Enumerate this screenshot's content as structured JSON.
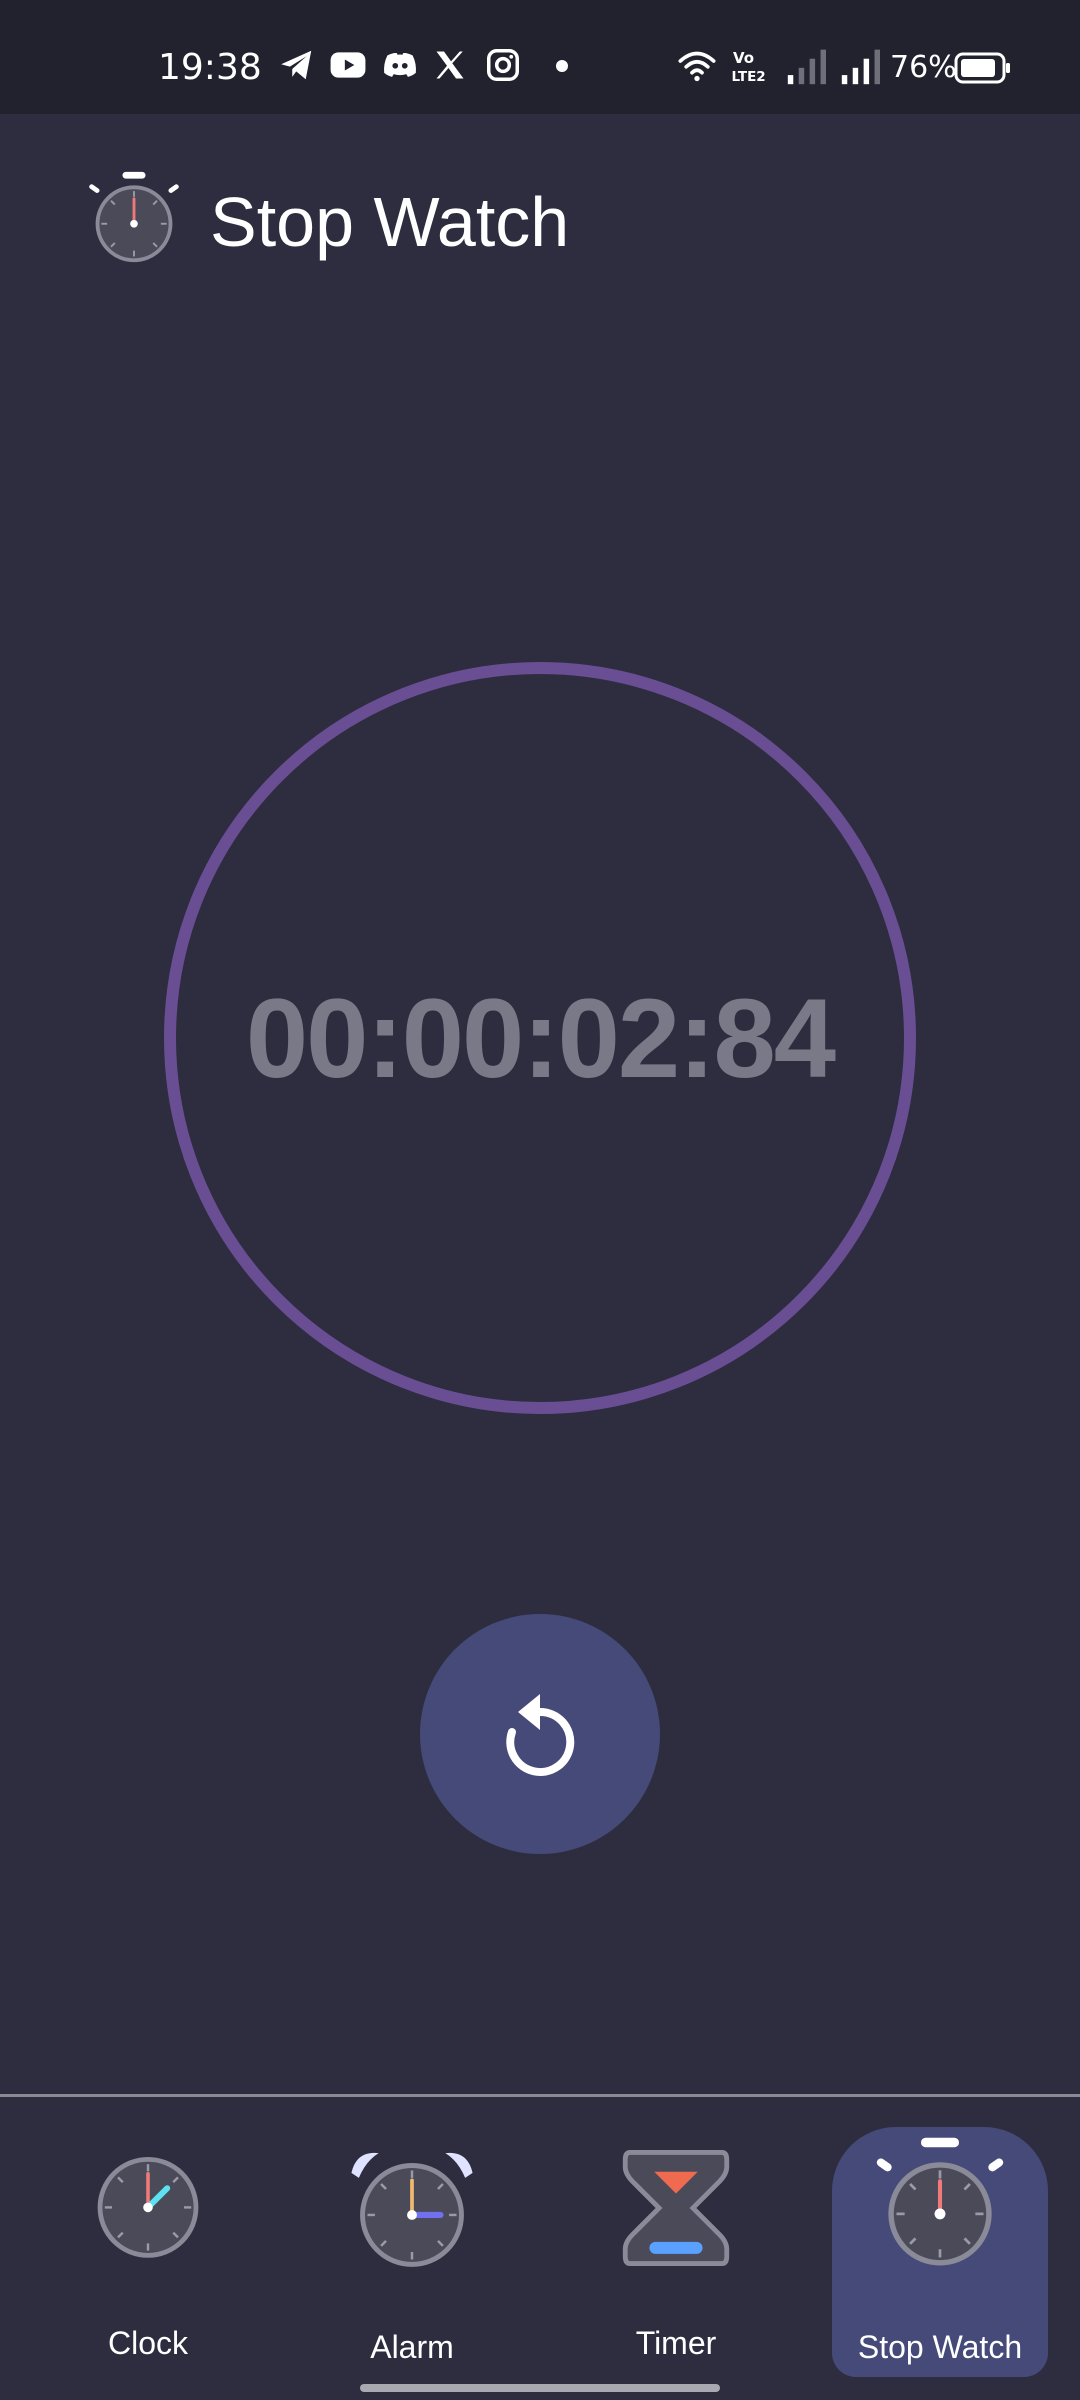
{
  "status_bar": {
    "time": "19:38",
    "battery": "76%",
    "notification_icons": [
      "telegram-icon",
      "youtube-icon",
      "discord-icon",
      "x-icon",
      "instagram-icon",
      "dot-icon"
    ],
    "system_icons": [
      "wifi-icon",
      "volte-icon",
      "signal-icon",
      "signal-icon",
      "battery-icon"
    ]
  },
  "header": {
    "title": "Stop Watch",
    "icon": "stopwatch-icon"
  },
  "stopwatch": {
    "elapsed": "00:00:02:84",
    "ring_color": "#6a4e94",
    "digits_color": "#7a7987"
  },
  "controls": {
    "reset_icon": "reset-icon"
  },
  "bottom_nav": {
    "items": [
      {
        "label": "Clock",
        "icon": "clock-icon",
        "active": false
      },
      {
        "label": "Alarm",
        "icon": "alarm-clock-icon",
        "active": false
      },
      {
        "label": "Timer",
        "icon": "hourglass-icon",
        "active": false
      },
      {
        "label": "Stop Watch",
        "icon": "stopwatch-icon",
        "active": true
      }
    ],
    "active_color": "#454a78"
  },
  "colors": {
    "background": "#2e2d40",
    "status_bar": "#22222f",
    "accent": "#6a4e94"
  }
}
